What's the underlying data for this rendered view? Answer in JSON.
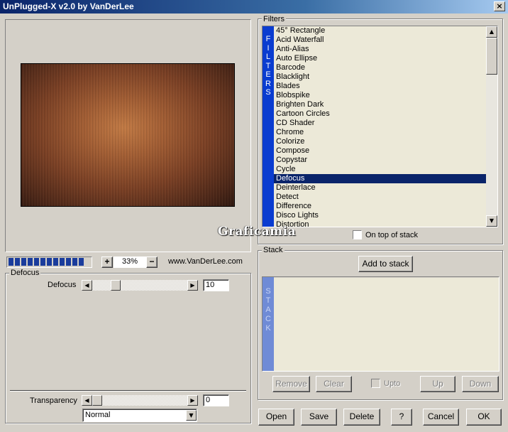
{
  "window": {
    "title": "UnPlugged-X v2.0 by VanDerLee",
    "close_label": "×"
  },
  "preview": {
    "progress_segments": 12,
    "zoom_plus": "+",
    "zoom_value": "33%",
    "zoom_minus": "−",
    "site": "www.VanDerLee.com"
  },
  "params": {
    "group_label": "Defocus",
    "defocus": {
      "label": "Defocus",
      "value": "10",
      "level": 0.1
    },
    "transparency": {
      "label": "Transparency",
      "value": "0",
      "level": 0.0
    },
    "blend_mode": "Normal"
  },
  "filters": {
    "group_label": "Filters",
    "strip_letters": [
      "F",
      "I",
      "L",
      "T",
      "E",
      "R",
      "S"
    ],
    "items": [
      "45° Rectangle",
      "Acid Waterfall",
      "Anti-Alias",
      "Auto Ellipse",
      "Barcode",
      "Blacklight",
      "Blades",
      "Blobspike",
      "Brighten Dark",
      "Cartoon Circles",
      "CD Shader",
      "Chrome",
      "Colorize",
      "Compose",
      "Copystar",
      "Cycle",
      "Defocus",
      "Deinterlace",
      "Detect",
      "Difference",
      "Disco Lights",
      "Distortion"
    ],
    "selected": "Defocus",
    "on_top_label": "On top of stack"
  },
  "stack": {
    "group_label": "Stack",
    "add_label": "Add to stack",
    "strip_letters": [
      "S",
      "T",
      "A",
      "C",
      "K"
    ],
    "remove_label": "Remove",
    "clear_label": "Clear",
    "upto_label": "Upto",
    "up_label": "Up",
    "down_label": "Down"
  },
  "footer": {
    "open_label": "Open",
    "save_label": "Save",
    "delete_label": "Delete",
    "help_label": "?",
    "cancel_label": "Cancel",
    "ok_label": "OK"
  },
  "watermark": "Graficamia",
  "colors": {
    "title_gradient_start": "#0a246a",
    "filters_strip": "#0a3cd0",
    "selection": "#0a246a",
    "stack_strip": "#6f8bd6"
  }
}
